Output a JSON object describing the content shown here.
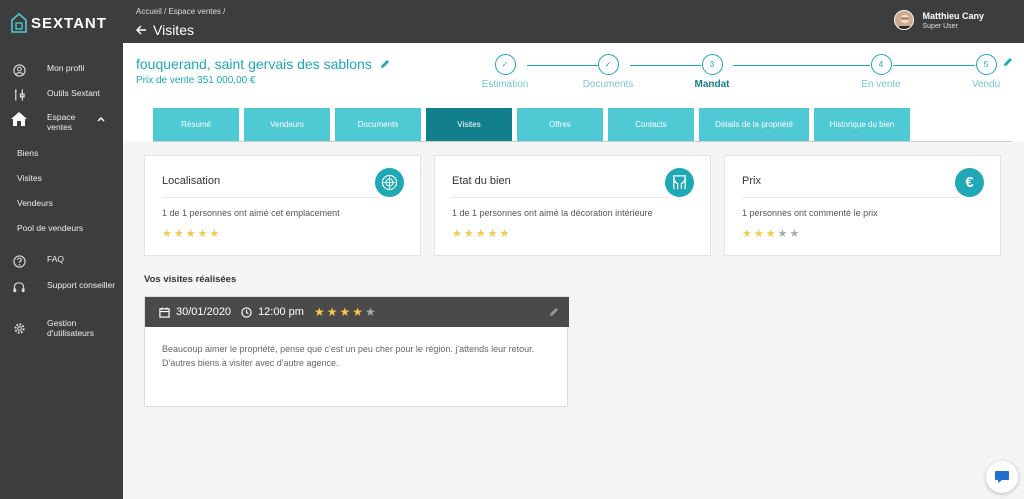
{
  "app": {
    "logo": "SEXTANT"
  },
  "sidebar": {
    "items": [
      {
        "label": "Mon profil",
        "icon": "user-circle-icon"
      },
      {
        "label": "Outils Sextant",
        "icon": "tools-icon"
      },
      {
        "label": "Espace ventes",
        "icon": "home-icon"
      },
      {
        "label": "FAQ",
        "icon": "question-icon"
      },
      {
        "label": "Support conseiller",
        "icon": "headset-icon"
      },
      {
        "label": "Gestion d'utilisateurs",
        "icon": "gear-icon"
      }
    ],
    "subitems": [
      "Biens",
      "Visites",
      "Vendeurs",
      "Pool de vendeurs"
    ]
  },
  "header": {
    "breadcrumb": "Accueil / Espace ventes /",
    "title": "Visites",
    "user_name": "Matthieu Cany",
    "user_role": "Super User"
  },
  "property": {
    "title": "fouquerand, saint gervais des sablons",
    "price": "Prix de vente 351 000,00 €"
  },
  "steps": [
    {
      "num": "✓",
      "label": "Estimation",
      "done": true
    },
    {
      "num": "✓",
      "label": "Documents",
      "done": true
    },
    {
      "num": "3",
      "label": "Mandat",
      "current": true
    },
    {
      "num": "4",
      "label": "En vente"
    },
    {
      "num": "5",
      "label": "Vendu"
    }
  ],
  "tabs": [
    "Résumé",
    "Vendeurs",
    "Documents",
    "Visites",
    "Offres",
    "Contacts",
    "Détails de la propriété",
    "Historique du bien"
  ],
  "active_tab": "Visites",
  "cards": [
    {
      "title": "Localisation",
      "text": "1 de 1 personnes ont aimé cet emplacement",
      "icon": "globe-icon",
      "rating": 5
    },
    {
      "title": "Etat du bien",
      "text": "1 de 1 personnes ont aimé la décoration intérieure",
      "icon": "curtains-icon",
      "rating": 5
    },
    {
      "title": "Prix",
      "text": "1 personnes ont commenté le prix",
      "icon": "euro-icon",
      "rating": 3
    }
  ],
  "visits_section": {
    "title": "Vos visites réalisées",
    "visit": {
      "date": "30/01/2020",
      "time": "12:00 pm",
      "rating": 4,
      "comment": "Beaucoup aimer le propriété, pense que c'est un peu cher pour le région. j'attends leur retour. D'autres biens à visiter avec d'autre agence."
    }
  },
  "colors": {
    "accent": "#1fa8b5",
    "tab": "#4fc9d4",
    "tab_active": "#12808c",
    "dark": "#3d3d3d",
    "star": "#f2c94c"
  }
}
